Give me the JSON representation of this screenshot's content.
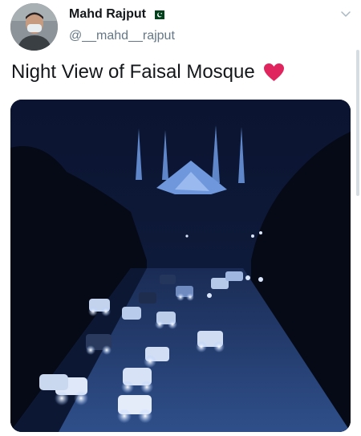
{
  "tweet": {
    "display_name": "Mahd Rajput",
    "handle": "@__mahd__rajput",
    "text": "Night View of Faisal Mosque",
    "emoji_icon": "red-heart-icon",
    "flag_icon": "pakistan-flag-icon",
    "menu_icon": "chevron-down-icon"
  },
  "colors": {
    "name": "#14171a",
    "handle": "#657786",
    "heart": "#e0245e",
    "flag_green": "#01411c",
    "media_sky": "#0e1a3a"
  }
}
